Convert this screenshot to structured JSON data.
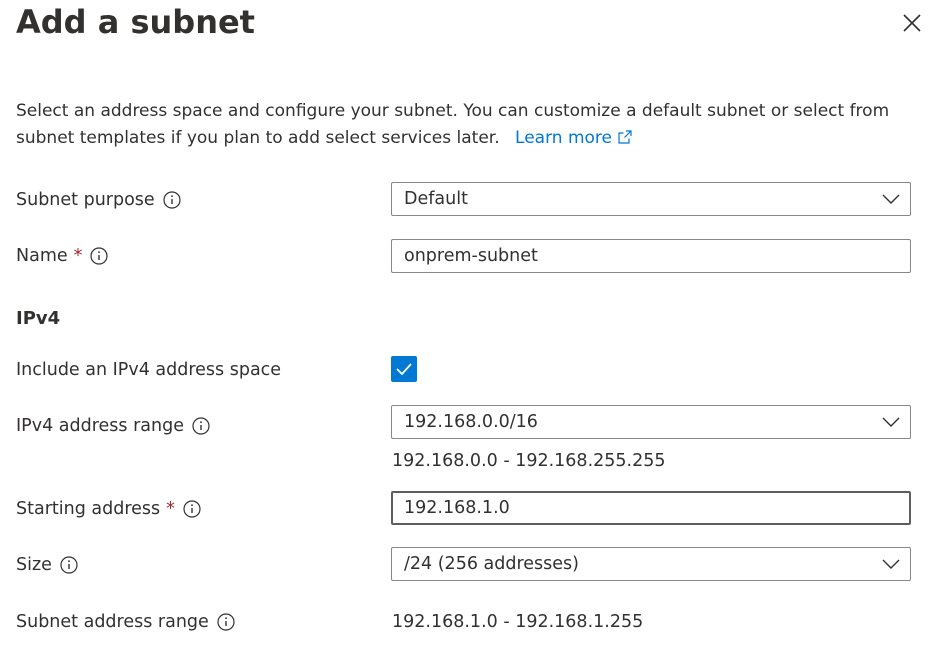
{
  "panel": {
    "title": "Add a subnet",
    "description": "Select an address space and configure your subnet. You can customize a default subnet or select from subnet templates if you plan to add select services later.",
    "learn_more": "Learn more"
  },
  "form": {
    "subnet_purpose": {
      "label": "Subnet purpose",
      "value": "Default"
    },
    "name": {
      "label": "Name",
      "required_mark": "*",
      "value": "onprem-subnet"
    },
    "ipv4_section": "IPv4",
    "include_ipv4": {
      "label": "Include an IPv4 address space",
      "checked": true
    },
    "ipv4_range": {
      "label": "IPv4 address range",
      "value": "192.168.0.0/16",
      "hint": "192.168.0.0 - 192.168.255.255"
    },
    "starting_address": {
      "label": "Starting address",
      "required_mark": "*",
      "value": "192.168.1.0"
    },
    "size": {
      "label": "Size",
      "value": "/24 (256 addresses)"
    },
    "subnet_range": {
      "label": "Subnet address range",
      "value": "192.168.1.0 - 192.168.1.255"
    }
  },
  "icons": {
    "close": "close-icon",
    "info": "info-icon",
    "external_link": "external-link-icon",
    "chevron": "chevron-down-icon",
    "check": "checkmark-icon"
  },
  "colors": {
    "accent": "#0078d4",
    "required": "#a4262c",
    "text": "#323130",
    "border": "#8a8886"
  }
}
